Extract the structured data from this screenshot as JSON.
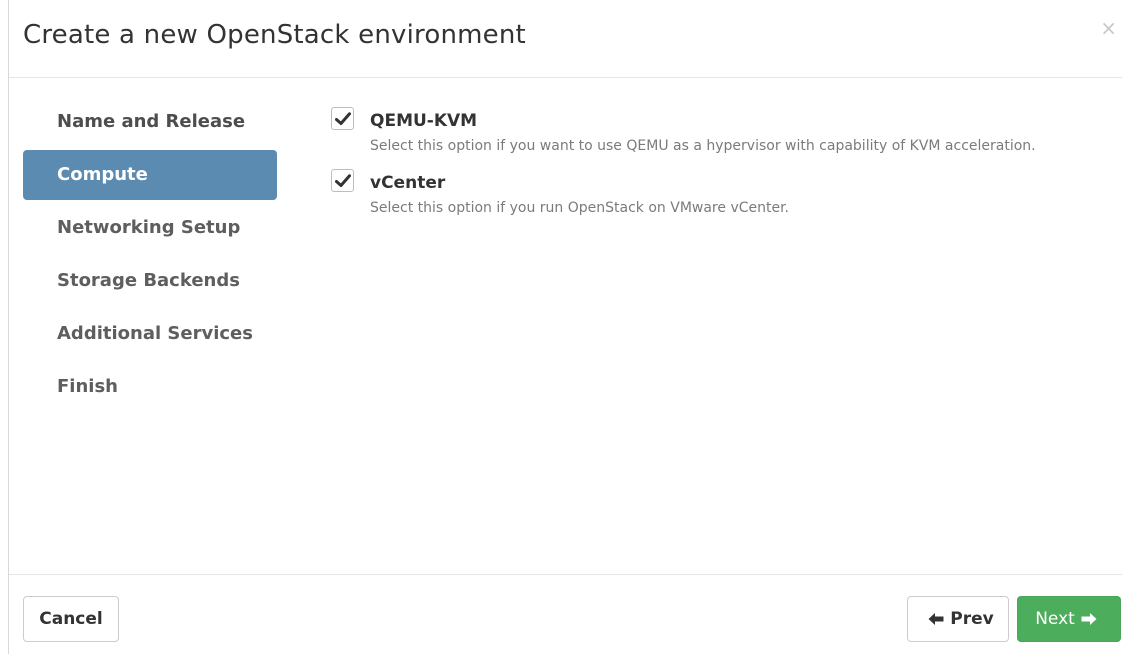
{
  "modal": {
    "title": "Create a new OpenStack environment",
    "close_glyph": "×"
  },
  "sidebar": {
    "items": [
      {
        "label": "Name and Release",
        "state": "completed"
      },
      {
        "label": "Compute",
        "state": "active"
      },
      {
        "label": "Networking Setup",
        "state": "pending"
      },
      {
        "label": "Storage Backends",
        "state": "pending"
      },
      {
        "label": "Additional Services",
        "state": "pending"
      },
      {
        "label": "Finish",
        "state": "pending"
      }
    ]
  },
  "options": [
    {
      "label": "QEMU-KVM",
      "description": "Select this option if you want to use QEMU as a hypervisor with capability of KVM acceleration.",
      "checked": true
    },
    {
      "label": "vCenter",
      "description": "Select this option if you run OpenStack on VMware vCenter.",
      "checked": true
    }
  ],
  "footer": {
    "cancel_label": "Cancel",
    "prev_label": "Prev",
    "next_label": "Next"
  },
  "icons": {
    "close": "close-icon",
    "check": "checkmark-icon",
    "prev": "arrow-left-icon",
    "next": "arrow-right-icon"
  },
  "colors": {
    "active_step": "#5b8bb0",
    "next_button": "#4cae5c",
    "title_text": "#333333",
    "description_text": "#7b7b7b"
  }
}
